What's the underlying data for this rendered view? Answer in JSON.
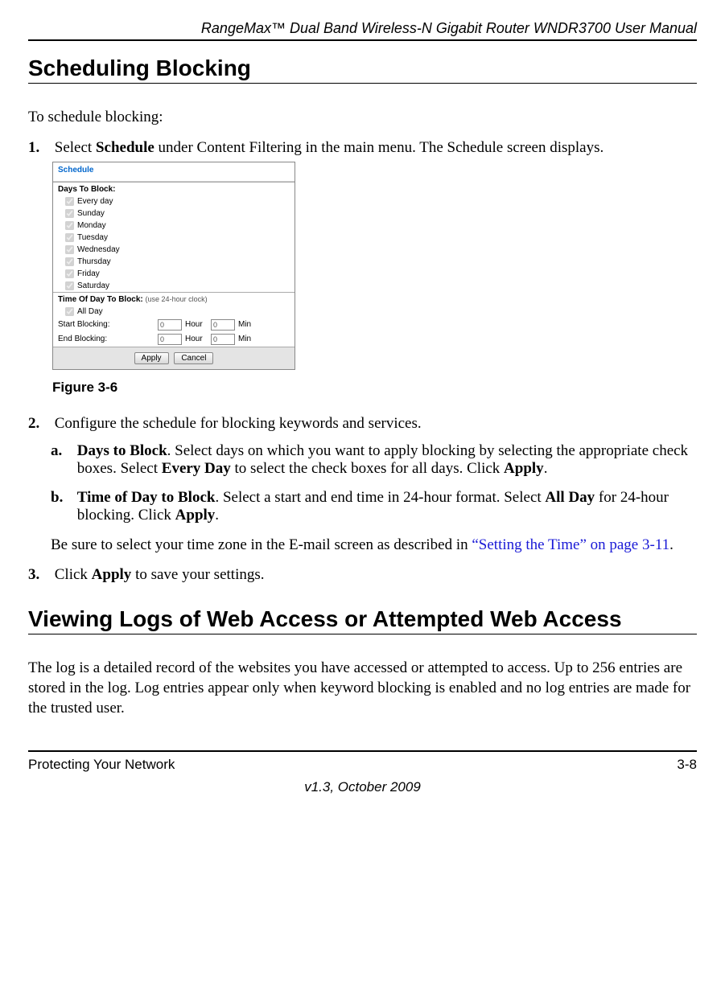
{
  "header": {
    "title": "RangeMax™ Dual Band Wireless-N Gigabit Router WNDR3700 User Manual"
  },
  "section1": {
    "heading": "Scheduling Blocking",
    "intro": "To schedule blocking:",
    "step1_num": "1.",
    "step1_a": "Select ",
    "step1_b": "Schedule",
    "step1_c": " under Content Filtering in the main menu. The Schedule screen displays.",
    "figure_caption": "Figure 3-6",
    "step2_num": "2.",
    "step2_text": "Configure the schedule for blocking keywords and services.",
    "step2a_num": "a.",
    "step2a_b1": "Days to Block",
    "step2a_t1": ". Select days on which you want to apply blocking by selecting the appropriate check boxes. Select ",
    "step2a_b2": "Every Day",
    "step2a_t2": " to select the check boxes for all days. Click ",
    "step2a_b3": "Apply",
    "step2a_t3": ".",
    "step2b_num": "b.",
    "step2b_b1": "Time of Day to Block",
    "step2b_t1": ". Select a start and end time in 24-hour format. Select ",
    "step2b_b2": "All Day",
    "step2b_t2": " for 24-hour blocking. Click ",
    "step2b_b3": "Apply",
    "step2b_t3": ".",
    "note_a": "Be sure to select your time zone in the E-mail screen as described in ",
    "note_link": "“Setting the Time” on page 3-11",
    "note_b": ".",
    "step3_num": "3.",
    "step3_a": "Click ",
    "step3_b": "Apply",
    "step3_c": " to save your settings."
  },
  "section2": {
    "heading": "Viewing Logs of Web Access or Attempted Web Access",
    "para": "The log is a detailed record of the websites you have accessed or attempted to access. Up to 256 entries are stored in the log. Log entries appear only when keyword blocking is enabled and no log entries are made for the trusted user."
  },
  "screenshot": {
    "title": "Schedule",
    "days_header": "Days To Block:",
    "days": [
      "Every day",
      "Sunday",
      "Monday",
      "Tuesday",
      "Wednesday",
      "Thursday",
      "Friday",
      "Saturday"
    ],
    "time_header": "Time Of Day To Block:",
    "time_note": "(use 24-hour clock)",
    "all_day": "All Day",
    "start": "Start Blocking:",
    "end": "End Blocking:",
    "hour": "Hour",
    "min": "Min",
    "val": "0",
    "apply": "Apply",
    "cancel": "Cancel"
  },
  "footer": {
    "left": "Protecting Your Network",
    "right": "3-8",
    "version": "v1.3, October 2009"
  }
}
